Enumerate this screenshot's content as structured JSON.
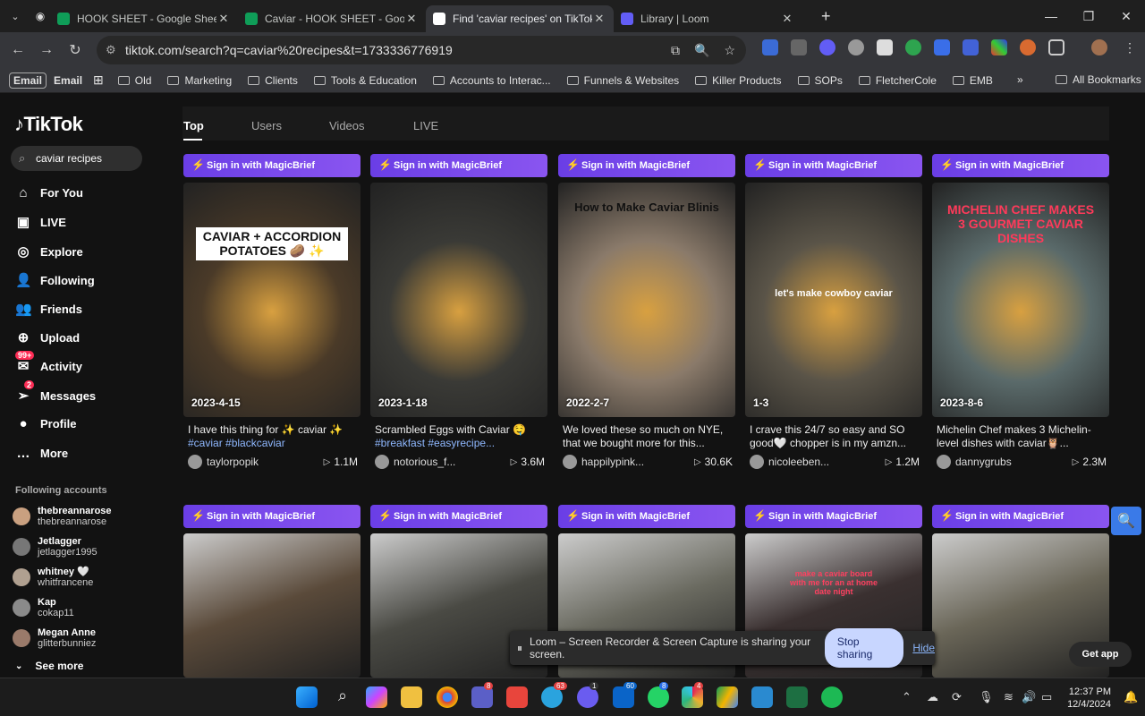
{
  "browser": {
    "tabs": [
      {
        "title": "HOOK SHEET - Google Sheets",
        "icon": "sheets-icon",
        "color": "#0f9d58"
      },
      {
        "title": "Caviar - HOOK SHEET - Google",
        "icon": "sheets-icon",
        "color": "#0f9d58"
      },
      {
        "title": "Find 'caviar recipes' on TikTok |",
        "icon": "tiktok-icon",
        "color": "#ffffff",
        "active": true
      },
      {
        "title": "Library | Loom",
        "icon": "loom-icon",
        "color": "#625df5"
      }
    ],
    "url": "tiktok.com/search?q=caviar%20recipes&t=1733336776919",
    "bookmarks": [
      "Old",
      "Marketing",
      "Clients",
      "Tools & Education",
      "Accounts to Interac...",
      "Funnels & Websites",
      "Killer Products",
      "SOPs",
      "FletcherCole",
      "EMB"
    ],
    "email_pills": [
      "Email",
      "Email"
    ],
    "all_bookmarks": "All Bookmarks"
  },
  "tiktok": {
    "logo": "TikTok",
    "search_value": "caviar recipes",
    "nav": [
      {
        "label": "For You",
        "icon": "home-icon"
      },
      {
        "label": "LIVE",
        "icon": "live-icon"
      },
      {
        "label": "Explore",
        "icon": "compass-icon"
      },
      {
        "label": "Following",
        "icon": "following-icon"
      },
      {
        "label": "Friends",
        "icon": "friends-icon"
      },
      {
        "label": "Upload",
        "icon": "upload-icon"
      },
      {
        "label": "Activity",
        "icon": "activity-icon",
        "badge": "99+"
      },
      {
        "label": "Messages",
        "icon": "messages-icon",
        "badge": "2"
      },
      {
        "label": "Profile",
        "icon": "profile-icon"
      },
      {
        "label": "More",
        "icon": "more-icon"
      }
    ],
    "following_title": "Following accounts",
    "following": [
      {
        "name": "thebreannarose",
        "handle": "thebreannarose"
      },
      {
        "name": "Jetlagger",
        "handle": "jetlagger1995"
      },
      {
        "name": "whitney 🤍",
        "handle": "whitfrancene"
      },
      {
        "name": "Kap",
        "handle": "cokap11"
      },
      {
        "name": "Megan Anne",
        "handle": "glitterbunniez"
      }
    ],
    "see_more": "See more",
    "result_tabs": [
      "Top",
      "Users",
      "Videos",
      "LIVE"
    ],
    "magic_label": "Sign in with MagicBrief",
    "videos": [
      {
        "date": "2023-4-15",
        "overlay": "CAVIAR + ACCORDION POTATOES 🥔 ✨",
        "desc": "I have this thing for ✨ caviar ✨",
        "tags": "#caviar #blackcaviar",
        "user": "taylorpopik",
        "views": "1.1M",
        "bg": "#4a3a28"
      },
      {
        "date": "2023-1-18",
        "overlay": "",
        "desc": "Scrambled Eggs with Caviar 🤤",
        "tags": "#breakfast #easyrecipe...",
        "user": "notorious_f...",
        "views": "3.6M",
        "bg": "#3a3a36"
      },
      {
        "date": "2022-2-7",
        "overlay": "How to Make Caviar Blinis",
        "desc": "We loved these so much on NYE, that we bought more for this...",
        "tags": "",
        "user": "happilypink...",
        "views": "30.6K",
        "bg": "#8a7a6a"
      },
      {
        "date": "1-3",
        "overlay": "let's make cowboy caviar",
        "desc": "I crave this 24/7 so easy and SO good🤍 chopper is in my amzn...",
        "tags": "",
        "user": "nicoleeben...",
        "views": "1.2M",
        "bg": "#5a5448"
      },
      {
        "date": "2023-8-6",
        "overlay": "MICHELIN CHEF MAKES 3 GOURMET CAVIAR DISHES",
        "desc": "Michelin Chef makes 3 Michelin-level dishes with caviar🦉...",
        "tags": "",
        "user": "dannygrubs",
        "views": "2.3M",
        "bg": "#5a6a6a"
      }
    ],
    "videos_row2": [
      {
        "bg": "#5a4a3a",
        "overlay": ""
      },
      {
        "bg": "#4a4a44",
        "overlay": ""
      },
      {
        "bg": "#6a6a60",
        "overlay": ""
      },
      {
        "bg": "#3a3030",
        "overlay": "make a caviar board with me for an at home date night"
      },
      {
        "bg": "#6a6658",
        "overlay": ""
      }
    ],
    "get_app": "Get app"
  },
  "loom": {
    "message": "Loom – Screen Recorder & Screen Capture is sharing your screen.",
    "stop": "Stop sharing",
    "hide": "Hide"
  },
  "taskbar": {
    "time": "12:37 PM",
    "date": "12/4/2024",
    "badges": [
      "8",
      "63",
      "1",
      "60",
      "8",
      "4"
    ]
  }
}
